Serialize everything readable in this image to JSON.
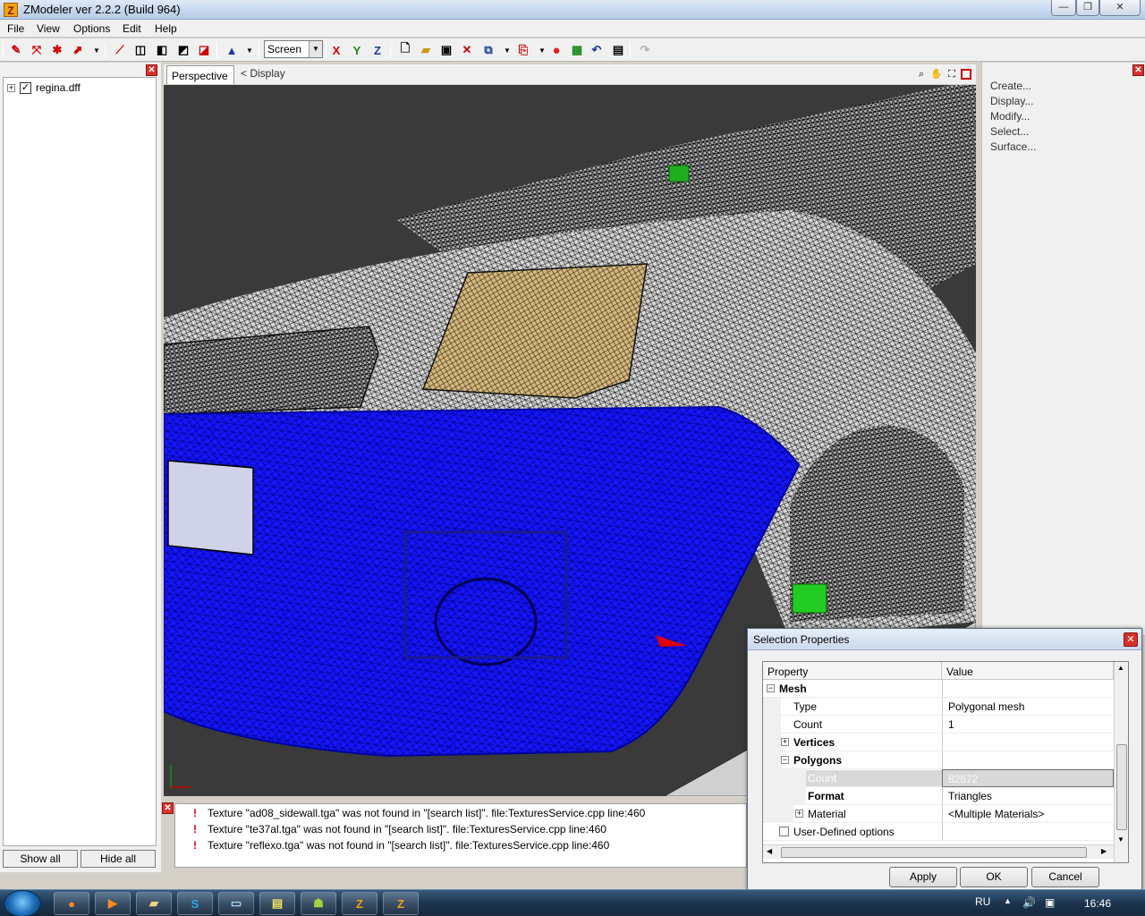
{
  "window": {
    "title": "ZModeler ver 2.2.2 (Build 964)",
    "app_icon_letter": "Z",
    "minimize": "—",
    "maximize": "❐",
    "close": "✕"
  },
  "menu": [
    "File",
    "View",
    "Options",
    "Edit",
    "Help"
  ],
  "toolbar": {
    "coord_mode": "Screen",
    "axis_x": "X",
    "axis_y": "Y",
    "axis_z": "Z"
  },
  "scene_tree": {
    "items": [
      {
        "label": "regina.dff",
        "checked": true,
        "expander": "+"
      }
    ],
    "show_all_label": "Show all",
    "hide_all_label": "Hide all"
  },
  "viewport": {
    "tab_label": "Perspective",
    "display_label": "<  Display"
  },
  "command_panel": {
    "items": [
      "Create...",
      "Display...",
      "Modify...",
      "Select...",
      "Surface..."
    ]
  },
  "log": {
    "messages": [
      "Texture \"ad08_sidewall.tga\" was not found in \"[search list]\". file:TexturesService.cpp line:460",
      "Texture \"te37al.tga\" was not found in \"[search list]\". file:TexturesService.cpp line:460",
      "Texture \"reflexo.tga\" was not found in \"[search list]\". file:TexturesService.cpp line:460"
    ]
  },
  "dialog": {
    "title": "Selection Properties",
    "col_property": "Property",
    "col_value": "Value",
    "rows": [
      {
        "name": "Mesh",
        "value": "",
        "bold": true,
        "expander": "−"
      },
      {
        "name": "Type",
        "value": "Polygonal mesh"
      },
      {
        "name": "Count",
        "value": "1"
      },
      {
        "name": "Vertices",
        "value": "",
        "bold": true,
        "expander": "+"
      },
      {
        "name": "Polygons",
        "value": "",
        "bold": true,
        "expander": "−"
      },
      {
        "name": "Count",
        "value": "82672",
        "selected": true
      },
      {
        "name": "Format",
        "value": "Triangles",
        "bold": true
      },
      {
        "name": "Material",
        "value": "<Multiple Materials>",
        "expander": "+"
      },
      {
        "name": "User-Defined options",
        "value": "",
        "checkbox": true
      }
    ],
    "apply_label": "Apply",
    "ok_label": "OK",
    "cancel_label": "Cancel"
  },
  "taskbar": {
    "language": "RU",
    "clock": "16:46",
    "apps": [
      "firefox-icon",
      "media-player-icon",
      "explorer-icon",
      "skype-icon",
      "window-icon",
      "terminal-icon",
      "android-icon",
      "zmodeler-icon",
      "zmodeler-icon"
    ]
  },
  "colors": {
    "selection_mesh": "#1010ff",
    "viewport_bg": "#3a3a3a",
    "error_icon": "#cc0000"
  }
}
